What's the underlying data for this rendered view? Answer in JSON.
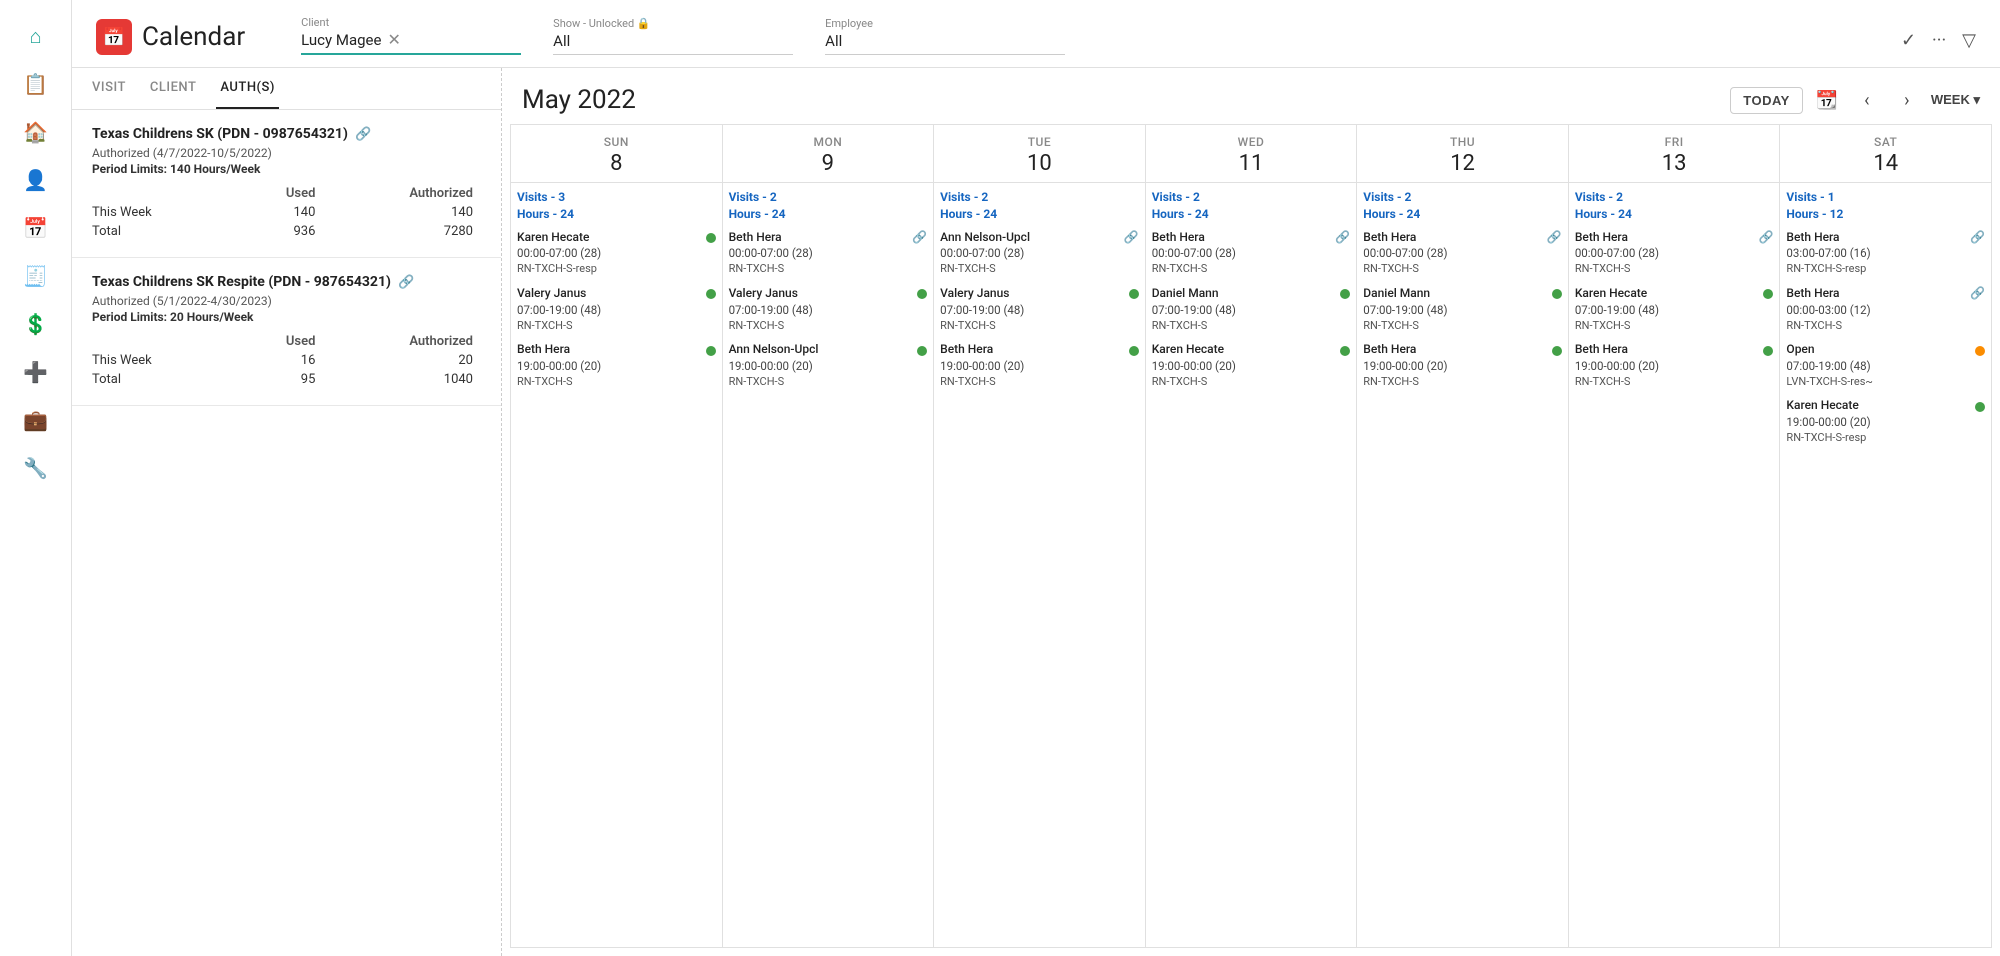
{
  "sidebar": {
    "icons": [
      {
        "name": "home-icon",
        "glyph": "⌂",
        "active": false
      },
      {
        "name": "document-icon",
        "glyph": "📋",
        "active": false
      },
      {
        "name": "house-icon",
        "glyph": "🏠",
        "active": false
      },
      {
        "name": "person-icon",
        "glyph": "👤",
        "active": false
      },
      {
        "name": "calendar-icon",
        "glyph": "📅",
        "active": true
      },
      {
        "name": "invoice-icon",
        "glyph": "🧾",
        "active": false
      },
      {
        "name": "dollar-icon",
        "glyph": "💲",
        "active": false
      },
      {
        "name": "plus-box-icon",
        "glyph": "➕",
        "active": false
      },
      {
        "name": "briefcase-icon",
        "glyph": "💼",
        "active": false
      },
      {
        "name": "tools-icon",
        "glyph": "🔧",
        "active": false
      }
    ]
  },
  "header": {
    "app_title": "Calendar",
    "client_label": "Client",
    "client_value": "Lucy Magee",
    "show_label": "Show - Unlocked 🔒",
    "show_value": "All",
    "employee_label": "Employee",
    "employee_value": "All"
  },
  "tabs": [
    "VISIT",
    "CLIENT",
    "AUTH(S)"
  ],
  "active_tab": "AUTH(S)",
  "auths": [
    {
      "title": "Texas Childrens SK (PDN - 0987654321)",
      "authorized_dates": "Authorized (4/7/2022-10/5/2022)",
      "period_limits": "140 Hours/Week",
      "rows": [
        {
          "label": "This Week",
          "used": "140",
          "authorized": "140"
        },
        {
          "label": "Total",
          "used": "936",
          "authorized": "7280"
        }
      ]
    },
    {
      "title": "Texas Childrens SK Respite (PDN - 987654321)",
      "authorized_dates": "Authorized (5/1/2022-4/30/2023)",
      "period_limits": "20 Hours/Week",
      "rows": [
        {
          "label": "This Week",
          "used": "16",
          "authorized": "20"
        },
        {
          "label": "Total",
          "used": "95",
          "authorized": "1040"
        }
      ]
    }
  ],
  "calendar": {
    "month_year": "May 2022",
    "today_label": "TODAY",
    "view_label": "WEEK ▾",
    "days": [
      {
        "name": "SUN",
        "num": "8"
      },
      {
        "name": "MON",
        "num": "9"
      },
      {
        "name": "TUE",
        "num": "10"
      },
      {
        "name": "WED",
        "num": "11"
      },
      {
        "name": "THU",
        "num": "12"
      },
      {
        "name": "FRI",
        "num": "13"
      },
      {
        "name": "SAT",
        "num": "14"
      }
    ],
    "day_columns": [
      {
        "summary": "Visits - 3\nHours - 24",
        "visits": [
          {
            "name": "Karen Hecate",
            "time": "00:00-07:00 (28)",
            "code": "RN-TXCH-S-resp",
            "dot": "green",
            "link": false
          },
          {
            "name": "Valery Janus",
            "time": "07:00-19:00 (48)",
            "code": "RN-TXCH-S",
            "dot": "green",
            "link": false
          },
          {
            "name": "Beth Hera",
            "time": "19:00-00:00 (20)",
            "code": "RN-TXCH-S",
            "dot": "green",
            "link": false
          }
        ]
      },
      {
        "summary": "Visits - 2\nHours - 24",
        "visits": [
          {
            "name": "Beth Hera",
            "time": "00:00-07:00 (28)",
            "code": "RN-TXCH-S",
            "dot": null,
            "link": true
          },
          {
            "name": "Valery Janus",
            "time": "07:00-19:00 (48)",
            "code": "RN-TXCH-S",
            "dot": "green",
            "link": false
          },
          {
            "name": "Ann Nelson-Upcl",
            "time": "19:00-00:00 (20)",
            "code": "RN-TXCH-S",
            "dot": "green",
            "link": false
          }
        ]
      },
      {
        "summary": "Visits - 2\nHours - 24",
        "visits": [
          {
            "name": "Ann Nelson-Upcl",
            "time": "00:00-07:00 (28)",
            "code": "RN-TXCH-S",
            "dot": null,
            "link": true
          },
          {
            "name": "Valery Janus",
            "time": "07:00-19:00 (48)",
            "code": "RN-TXCH-S",
            "dot": "green",
            "link": false
          },
          {
            "name": "Beth Hera",
            "time": "19:00-00:00 (20)",
            "code": "RN-TXCH-S",
            "dot": "green",
            "link": false
          }
        ]
      },
      {
        "summary": "Visits - 2\nHours - 24",
        "visits": [
          {
            "name": "Beth Hera",
            "time": "00:00-07:00 (28)",
            "code": "RN-TXCH-S",
            "dot": null,
            "link": true
          },
          {
            "name": "Daniel Mann",
            "time": "07:00-19:00 (48)",
            "code": "RN-TXCH-S",
            "dot": "green",
            "link": false
          },
          {
            "name": "Karen Hecate",
            "time": "19:00-00:00 (20)",
            "code": "RN-TXCH-S",
            "dot": "green",
            "link": false
          }
        ]
      },
      {
        "summary": "Visits - 2\nHours - 24",
        "visits": [
          {
            "name": "Beth Hera",
            "time": "00:00-07:00 (28)",
            "code": "RN-TXCH-S",
            "dot": null,
            "link": true
          },
          {
            "name": "Daniel Mann",
            "time": "07:00-19:00 (48)",
            "code": "RN-TXCH-S",
            "dot": "green",
            "link": false
          },
          {
            "name": "Beth Hera",
            "time": "19:00-00:00 (20)",
            "code": "RN-TXCH-S",
            "dot": "green",
            "link": false
          }
        ]
      },
      {
        "summary": "Visits - 2\nHours - 24",
        "visits": [
          {
            "name": "Beth Hera",
            "time": "00:00-07:00 (28)",
            "code": "RN-TXCH-S",
            "dot": null,
            "link": true
          },
          {
            "name": "Karen Hecate",
            "time": "07:00-19:00 (48)",
            "code": "RN-TXCH-S",
            "dot": "green",
            "link": false
          },
          {
            "name": "Beth Hera",
            "time": "19:00-00:00 (20)",
            "code": "RN-TXCH-S",
            "dot": "green",
            "link": false
          }
        ]
      },
      {
        "summary": "Visits - 1\nHours - 12",
        "visits": [
          {
            "name": "Beth Hera",
            "time": "03:00-07:00 (16)",
            "code": "RN-TXCH-S-resp",
            "dot": null,
            "link": true
          },
          {
            "name": "Beth Hera",
            "time": "00:00-03:00 (12)",
            "code": "RN-TXCH-S",
            "dot": null,
            "link": true
          },
          {
            "name": "Open",
            "time": "07:00-19:00 (48)",
            "code": "LVN-TXCH-S-res~",
            "dot": "orange",
            "link": false
          },
          {
            "name": "Karen Hecate",
            "time": "19:00-00:00 (20)",
            "code": "RN-TXCH-S-resp",
            "dot": "green",
            "link": false
          }
        ]
      }
    ]
  }
}
